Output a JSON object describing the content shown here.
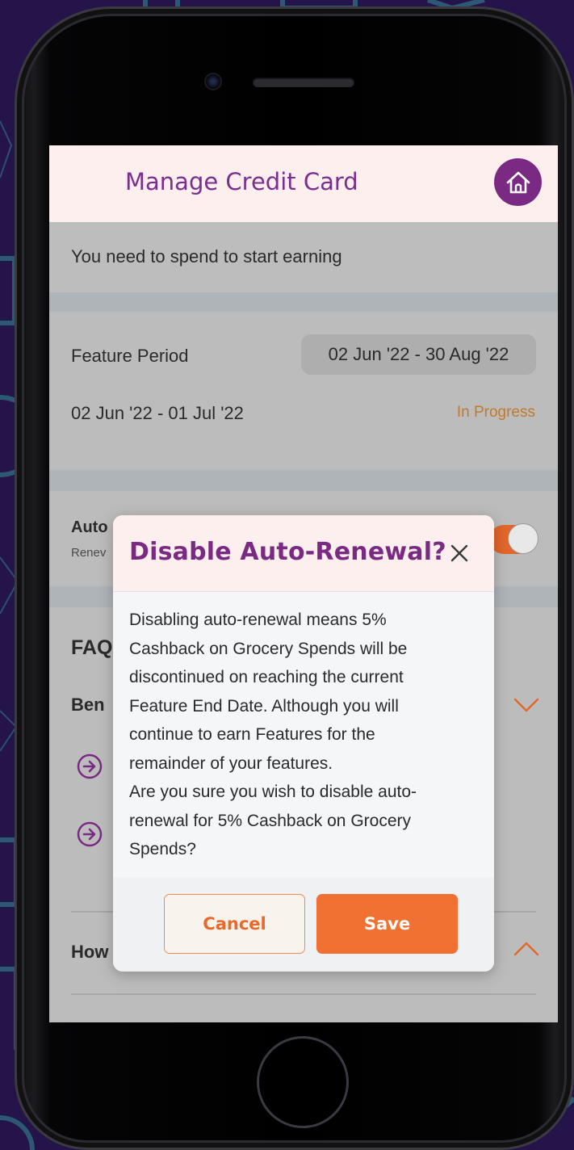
{
  "header": {
    "title": "Manage Credit Card",
    "home_icon": "home-icon"
  },
  "spend": {
    "message": "You need to spend to start earning"
  },
  "feature_period": {
    "label": "Feature Period",
    "range": "02 Jun '22 - 30 Aug '22",
    "cycle": "02 Jun '22 - 01 Jul '22",
    "status": "In Progress"
  },
  "auto_renewal": {
    "title": "Auto",
    "subtitle": "Renev",
    "enabled": true
  },
  "faq": {
    "title": "FAQ",
    "q1": "Ben",
    "q2": "How"
  },
  "dialog": {
    "title": "Disable Auto-Renewal?",
    "body_lines": [
      "Disabling auto-renewal means 5%",
      "Cashback on Grocery Spends will be",
      "discontinued on reaching the current",
      "Feature End Date. Although you will",
      "continue to earn Features for the",
      "remainder of your features.",
      "Are you sure you wish to disable auto-",
      "renewal for 5% Cashback on Grocery",
      "Spends?"
    ],
    "cancel_label": "Cancel",
    "save_label": "Save"
  },
  "colors": {
    "brand_purple": "#7a2a83",
    "accent_orange": "#f07132",
    "status_amber": "#c27a28",
    "header_tint": "#fcefed"
  }
}
